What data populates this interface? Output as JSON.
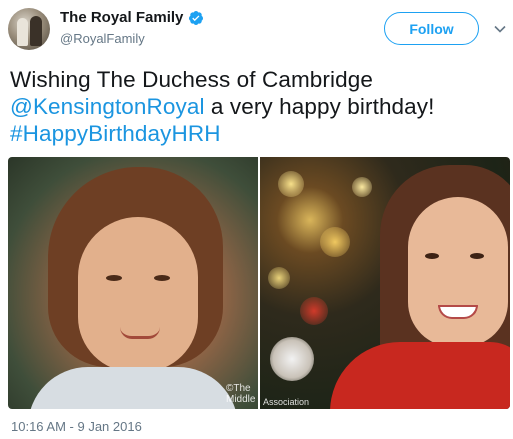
{
  "account": {
    "display_name": "The Royal Family",
    "handle": "@RoyalFamily",
    "verified": true,
    "avatar_icon": "avatar-photo"
  },
  "follow_button": {
    "label": "Follow"
  },
  "more_menu": {
    "icon": "chevron-down-icon"
  },
  "tweet": {
    "line1": "Wishing The Duchess of Cambridge",
    "mention": "@KensingtonRoyal",
    "line2_rest": " a very happy birthday!",
    "hashtag": "#HappyBirthdayHRH"
  },
  "media": {
    "watermark_left": "©The Middle",
    "watermark_right": "Association"
  },
  "timestamp": "10:16 AM - 9 Jan 2016",
  "colors": {
    "link": "#1b95e0",
    "follow": "#1da1f2",
    "muted": "#657786",
    "text": "#14171a"
  }
}
